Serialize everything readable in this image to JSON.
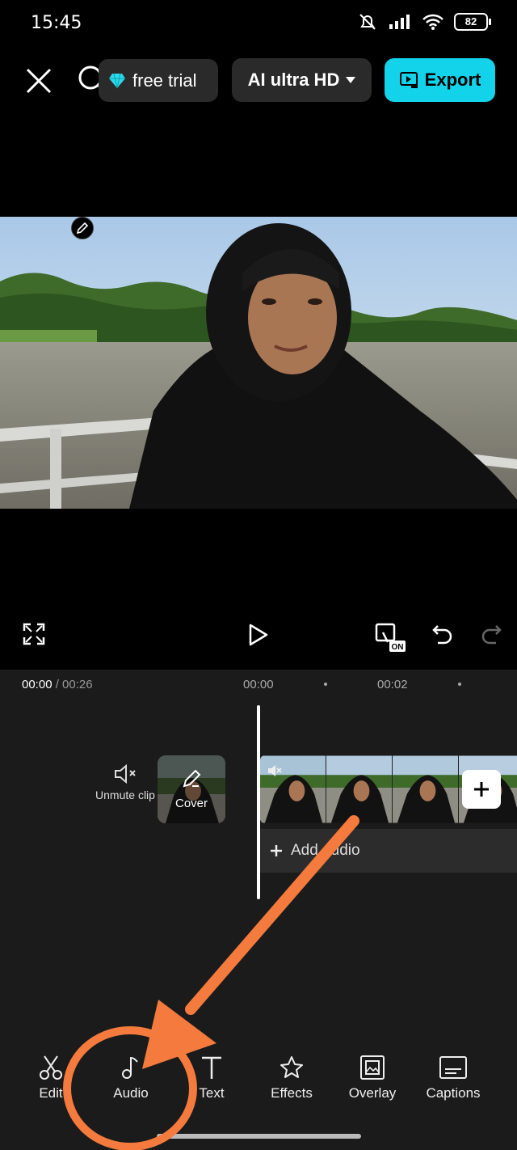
{
  "status_bar": {
    "time": "15:45",
    "battery": "82"
  },
  "top_bar": {
    "trial_label": "free trial",
    "quality_label": "AI ultra HD",
    "export_label": "Export"
  },
  "timeline": {
    "current_time": "00:00",
    "total_time": "/ 00:26",
    "ruler_marks": [
      "00:00",
      "00:02"
    ],
    "unmute_label": "Unmute clip",
    "cover_label": "Cover",
    "add_audio_label": "Add audio"
  },
  "toolbar": {
    "items": [
      {
        "label": "Edit",
        "icon": "scissors-icon"
      },
      {
        "label": "Audio",
        "icon": "music-note-icon"
      },
      {
        "label": "Text",
        "icon": "text-icon"
      },
      {
        "label": "Effects",
        "icon": "effects-star-icon"
      },
      {
        "label": "Overlay",
        "icon": "overlay-icon"
      },
      {
        "label": "Captions",
        "icon": "captions-icon"
      }
    ]
  },
  "colors": {
    "accent": "#12d3ea",
    "annotation": "#f57a3d",
    "panel": "#1b1b1b"
  }
}
